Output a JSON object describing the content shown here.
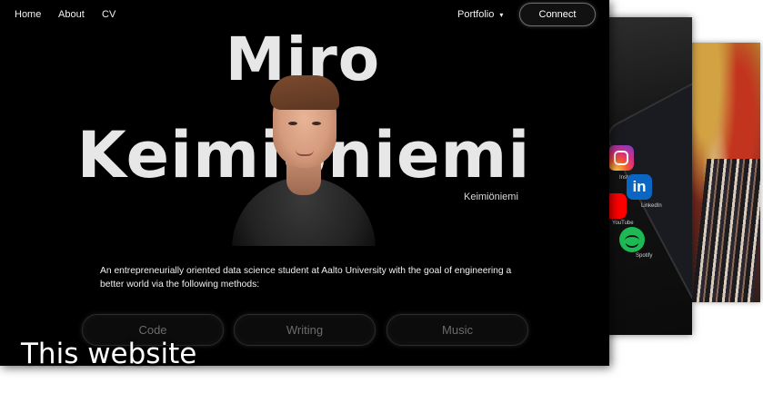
{
  "nav": {
    "home_label": "Home",
    "about_label": "About",
    "cv_label": "CV",
    "portfolio_label": "Portfolio",
    "portfolio_caret": "▾",
    "connect_label": "Connect"
  },
  "hero": {
    "first_name": "Miro",
    "last_name": "Keimiöniemi",
    "surname_tag": "Keimiöniemi",
    "intro_text": "An entrepreneurially oriented data science student at Aalto University with the goal of engineering a better world via the following methods:"
  },
  "methods": [
    {
      "label": "Code"
    },
    {
      "label": "Writing"
    },
    {
      "label": "Music"
    }
  ],
  "preview_cards": {
    "phone_apps": [
      {
        "name": "Instagram",
        "icon": "instagram-icon"
      },
      {
        "name": "LinkedIn",
        "icon": "linkedin-icon"
      },
      {
        "name": "YouTube",
        "icon": "youtube-icon"
      },
      {
        "name": "Spotify",
        "icon": "spotify-icon"
      }
    ]
  },
  "caption": "This website",
  "colors": {
    "page_bg": "#000000",
    "accent_text": "#e7e7e7",
    "button_text": "#6b6b6b"
  }
}
